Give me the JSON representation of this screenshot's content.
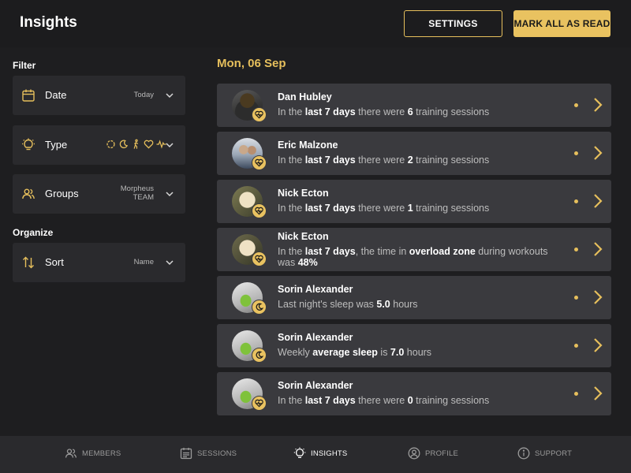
{
  "header": {
    "title": "Insights",
    "settings_label": "SETTINGS",
    "mark_all_label": "MARK ALL AS READ"
  },
  "sidebar": {
    "filter_heading": "Filter",
    "organize_heading": "Organize",
    "date": {
      "label": "Date",
      "value": "Today"
    },
    "type": {
      "label": "Type",
      "icons": [
        "activity-ring-icon",
        "moon-icon",
        "walking-icon",
        "heart-icon",
        "pulse-icon"
      ]
    },
    "groups": {
      "label": "Groups",
      "value_line1": "Morpheus",
      "value_line2": "TEAM"
    },
    "sort": {
      "label": "Sort",
      "value": "Name"
    }
  },
  "main": {
    "date_heading": "Mon, 06 Sep",
    "insights": [
      {
        "name": "Dan Hubley",
        "parts": [
          "In the ",
          "last 7 days",
          " there were ",
          "6",
          " training sessions"
        ],
        "badge": "heart-icon",
        "unread": true
      },
      {
        "name": "Eric Malzone",
        "parts": [
          "In the ",
          "last 7 days",
          " there were ",
          "2",
          " training sessions"
        ],
        "badge": "heart-icon",
        "unread": true
      },
      {
        "name": "Nick Ecton",
        "parts": [
          "In the ",
          "last 7 days",
          " there were ",
          "1",
          " training sessions"
        ],
        "badge": "heart-icon",
        "unread": true
      },
      {
        "name": "Nick Ecton",
        "parts": [
          "In the ",
          "last 7 days",
          ", the time in ",
          "overload zone",
          " during workouts was ",
          "48%"
        ],
        "badge": "heart-icon",
        "unread": true
      },
      {
        "name": "Sorin Alexander",
        "parts": [
          "Last night's sleep was ",
          "5.0",
          " hours"
        ],
        "badge": "moon-icon",
        "unread": true
      },
      {
        "name": "Sorin Alexander",
        "parts": [
          "Weekly ",
          "average sleep",
          " is ",
          "7.0",
          " hours"
        ],
        "badge": "moon-icon",
        "unread": true
      },
      {
        "name": "Sorin Alexander",
        "parts": [
          "In the ",
          "last 7 days",
          " there were ",
          "0",
          " training sessions"
        ],
        "badge": "heart-icon",
        "unread": true
      }
    ]
  },
  "nav": {
    "members": "MEMBERS",
    "sessions": "SESSIONS",
    "insights": "INSIGHTS",
    "profile": "PROFILE",
    "support": "SUPPORT"
  },
  "colors": {
    "accent": "#e6bf5c",
    "background": "#1e1e20",
    "card": "#3a3a3e",
    "sidebar_card": "#2a2a2d"
  }
}
